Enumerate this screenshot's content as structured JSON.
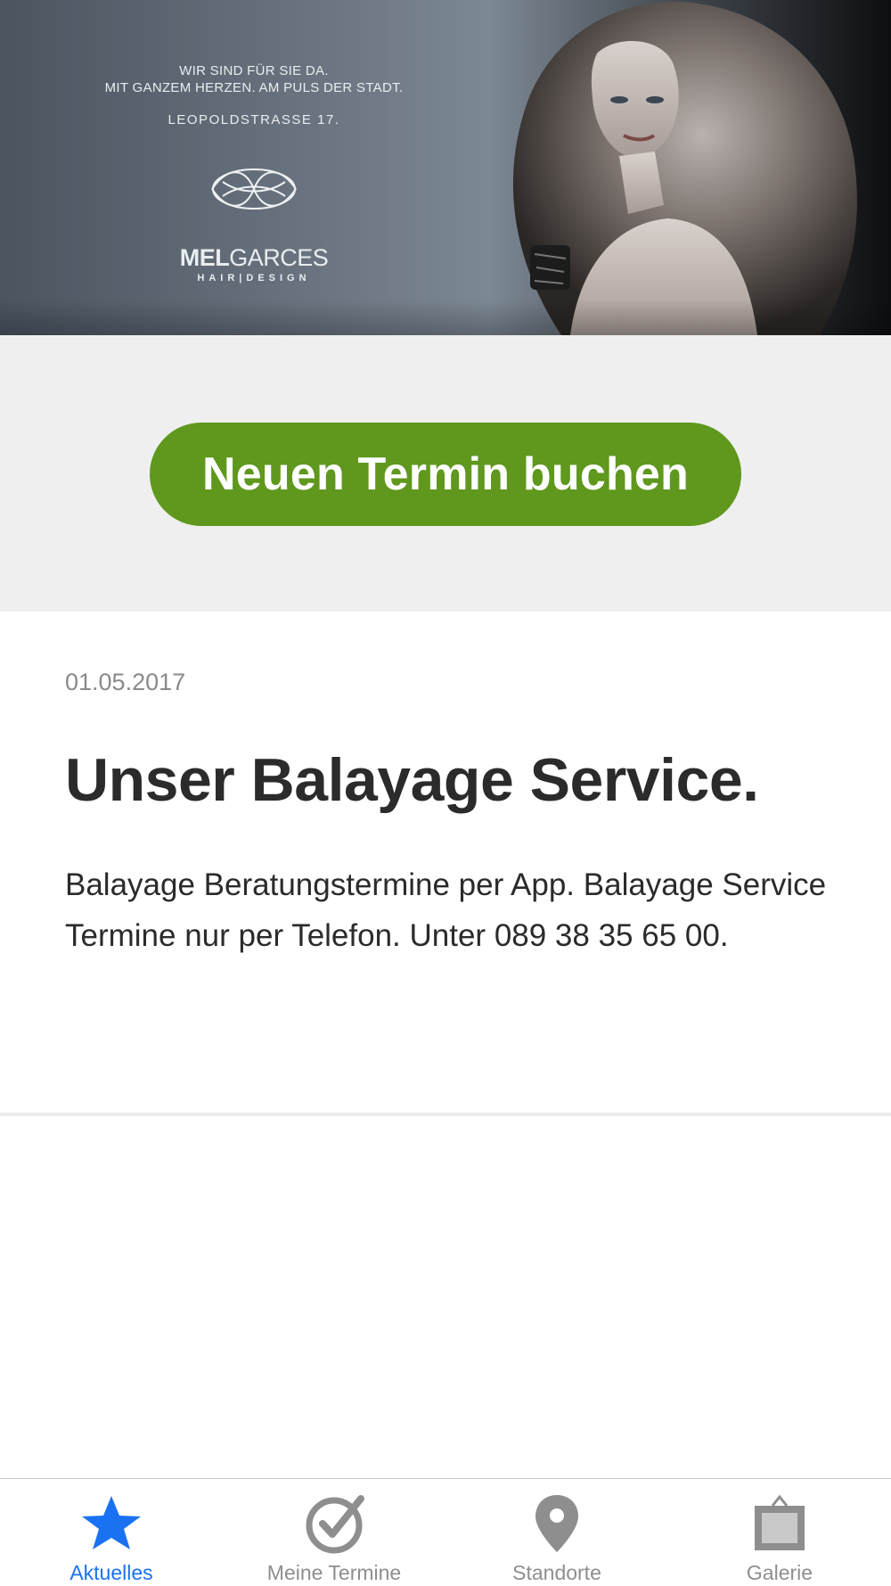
{
  "banner": {
    "tagline_line1": "WIR SIND FÜR SIE DA.",
    "tagline_line2": "MIT GANZEM HERZEN. AM PULS DER STADT.",
    "address": "LEOPOLDSTRASSE 17.",
    "brand_bold": "MEL",
    "brand_light": "GARCES",
    "brand_sub": "HAIR|DESIGN"
  },
  "booking": {
    "button_label": "Neuen Termin buchen",
    "button_color": "#5f981d"
  },
  "news": {
    "date": "01.05.2017",
    "title": "Unser Balayage Service.",
    "body": "Balayage Beratungstermine per App. Balayage Service Termine nur per Telefon. Unter 089 38 35 65 00."
  },
  "tabbar": {
    "active_color": "#1a72f2",
    "inactive_color": "#8e8e8e",
    "tabs": [
      {
        "label": "Aktuelles",
        "icon": "star-icon",
        "active": true
      },
      {
        "label": "Meine Termine",
        "icon": "checkmark-circle-icon",
        "active": false
      },
      {
        "label": "Standorte",
        "icon": "map-pin-icon",
        "active": false
      },
      {
        "label": "Galerie",
        "icon": "gallery-icon",
        "active": false
      }
    ]
  }
}
